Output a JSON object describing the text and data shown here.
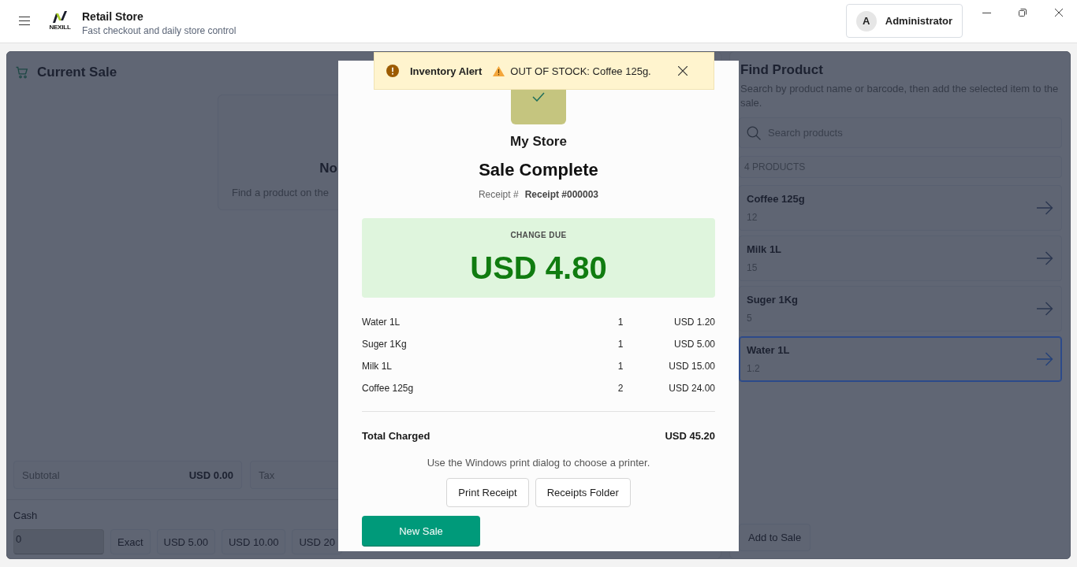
{
  "window": {
    "title": "Retail Store",
    "subtitle": "Fast checkout and daily store control",
    "logo_text": "NEXILL"
  },
  "user": {
    "initial": "A",
    "name": "Administrator"
  },
  "current_sale": {
    "title": "Current Sale",
    "empty_state": {
      "title": "No",
      "text": "Find a product on the"
    },
    "totals": [
      {
        "label": "Subtotal",
        "value": "USD 0.00"
      },
      {
        "label": "Tax"
      }
    ],
    "cash": {
      "label": "Cash",
      "value": "0",
      "quick_amounts": [
        "Exact",
        "USD 5.00",
        "USD 10.00",
        "USD 20"
      ]
    }
  },
  "find_product": {
    "title": "Find Product",
    "description": "Search by product name or barcode, then add the selected item to the sale.",
    "search": {
      "placeholder": "Search products"
    },
    "count": "4 PRODUCTS",
    "products": [
      {
        "name": "Coffee 125g",
        "stock": "12",
        "selected": false
      },
      {
        "name": "Milk 1L",
        "stock": "15",
        "selected": false
      },
      {
        "name": "Suger 1Kg",
        "stock": "5",
        "selected": false
      },
      {
        "name": "Water 1L",
        "stock": "1.2",
        "selected": true
      }
    ],
    "add_button": "Add to Sale"
  },
  "receipt_dialog": {
    "store_name": "My Store",
    "title": "Sale Complete",
    "receipt_label": "Receipt #",
    "receipt_number": "Receipt #000003",
    "change_label": "CHANGE DUE",
    "change_amount": "USD 4.80",
    "items": [
      {
        "name": "Water 1L",
        "qty": "1",
        "price": "USD 1.20"
      },
      {
        "name": "Suger 1Kg",
        "qty": "1",
        "price": "USD 5.00"
      },
      {
        "name": "Milk 1L",
        "qty": "1",
        "price": "USD 15.00"
      },
      {
        "name": "Coffee 125g",
        "qty": "2",
        "price": "USD 24.00"
      }
    ],
    "total_label": "Total Charged",
    "total_value": "USD 45.20",
    "note": "Use the Windows print dialog to choose a printer.",
    "buttons": [
      "Print Receipt",
      "Receipts Folder"
    ],
    "primary_button": "New Sale"
  },
  "inventory_alert": {
    "title": "Inventory Alert",
    "message": "OUT OF STOCK: Coffee 125g."
  }
}
